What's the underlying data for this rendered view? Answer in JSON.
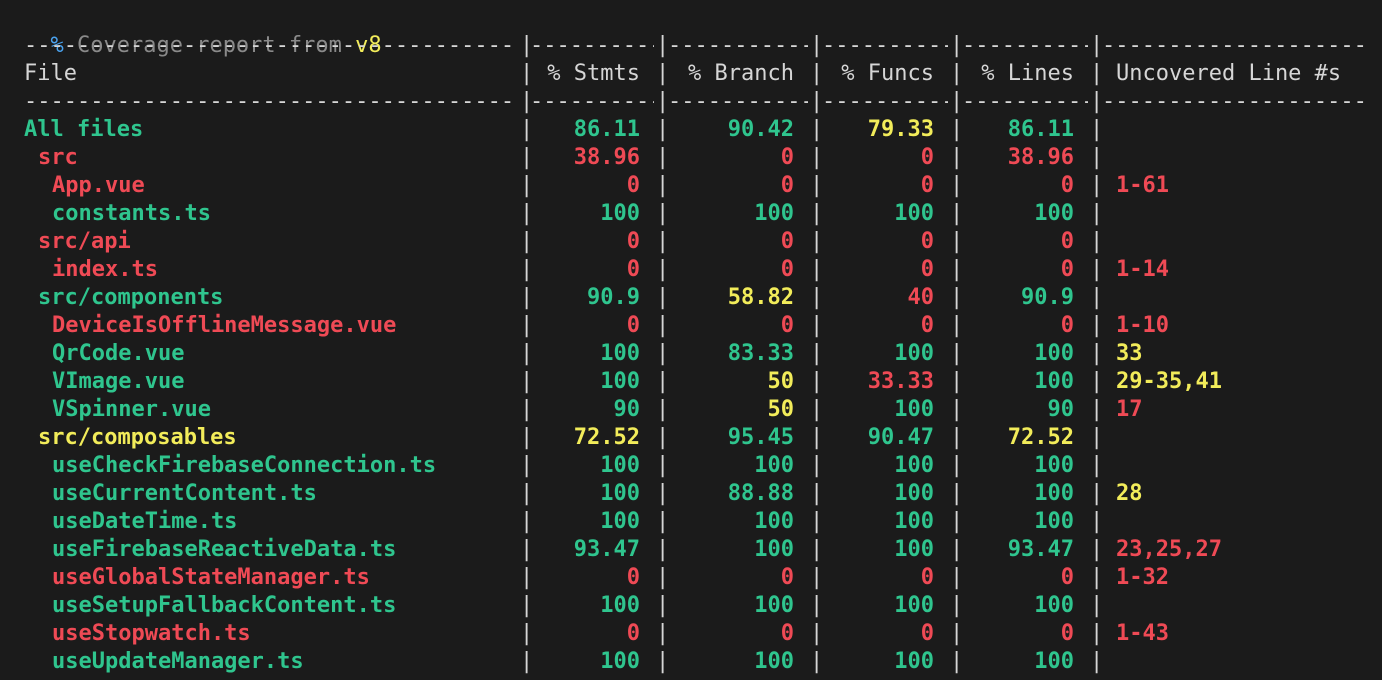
{
  "title": {
    "prefix": "%",
    "text": " Coverage report from ",
    "provider": "v8"
  },
  "columns": {
    "file": "File",
    "stmts": "% Stmts",
    "branch": "% Branch",
    "funcs": "% Funcs",
    "lines": "% Lines",
    "uncovered": "Uncovered Line #s"
  },
  "colors": {
    "green": "#2fc58e",
    "red": "#ef4a55",
    "yellow": "#f2ec5a",
    "background": "#1b1b1b"
  },
  "rows": [
    {
      "file": "All files",
      "indent": 0,
      "fileColor": "green",
      "stmts": "86.11",
      "stmtsColor": "green",
      "branch": "90.42",
      "branchColor": "green",
      "funcs": "79.33",
      "funcsColor": "yellow",
      "lines": "86.11",
      "linesColor": "green",
      "uncovered": "",
      "uncoveredColor": "red"
    },
    {
      "file": "src",
      "indent": 1,
      "fileColor": "red",
      "stmts": "38.96",
      "stmtsColor": "red",
      "branch": "0",
      "branchColor": "red",
      "funcs": "0",
      "funcsColor": "red",
      "lines": "38.96",
      "linesColor": "red",
      "uncovered": "",
      "uncoveredColor": "red"
    },
    {
      "file": "App.vue",
      "indent": 2,
      "fileColor": "red",
      "stmts": "0",
      "stmtsColor": "red",
      "branch": "0",
      "branchColor": "red",
      "funcs": "0",
      "funcsColor": "red",
      "lines": "0",
      "linesColor": "red",
      "uncovered": "1-61",
      "uncoveredColor": "red"
    },
    {
      "file": "constants.ts",
      "indent": 2,
      "fileColor": "green",
      "stmts": "100",
      "stmtsColor": "green",
      "branch": "100",
      "branchColor": "green",
      "funcs": "100",
      "funcsColor": "green",
      "lines": "100",
      "linesColor": "green",
      "uncovered": "",
      "uncoveredColor": "red"
    },
    {
      "file": "src/api",
      "indent": 1,
      "fileColor": "red",
      "stmts": "0",
      "stmtsColor": "red",
      "branch": "0",
      "branchColor": "red",
      "funcs": "0",
      "funcsColor": "red",
      "lines": "0",
      "linesColor": "red",
      "uncovered": "",
      "uncoveredColor": "red"
    },
    {
      "file": "index.ts",
      "indent": 2,
      "fileColor": "red",
      "stmts": "0",
      "stmtsColor": "red",
      "branch": "0",
      "branchColor": "red",
      "funcs": "0",
      "funcsColor": "red",
      "lines": "0",
      "linesColor": "red",
      "uncovered": "1-14",
      "uncoveredColor": "red"
    },
    {
      "file": "src/components",
      "indent": 1,
      "fileColor": "green",
      "stmts": "90.9",
      "stmtsColor": "green",
      "branch": "58.82",
      "branchColor": "yellow",
      "funcs": "40",
      "funcsColor": "red",
      "lines": "90.9",
      "linesColor": "green",
      "uncovered": "",
      "uncoveredColor": "red"
    },
    {
      "file": "DeviceIsOfflineMessage.vue",
      "indent": 2,
      "fileColor": "red",
      "stmts": "0",
      "stmtsColor": "red",
      "branch": "0",
      "branchColor": "red",
      "funcs": "0",
      "funcsColor": "red",
      "lines": "0",
      "linesColor": "red",
      "uncovered": "1-10",
      "uncoveredColor": "red"
    },
    {
      "file": "QrCode.vue",
      "indent": 2,
      "fileColor": "green",
      "stmts": "100",
      "stmtsColor": "green",
      "branch": "83.33",
      "branchColor": "green",
      "funcs": "100",
      "funcsColor": "green",
      "lines": "100",
      "linesColor": "green",
      "uncovered": "33",
      "uncoveredColor": "yellow"
    },
    {
      "file": "VImage.vue",
      "indent": 2,
      "fileColor": "green",
      "stmts": "100",
      "stmtsColor": "green",
      "branch": "50",
      "branchColor": "yellow",
      "funcs": "33.33",
      "funcsColor": "red",
      "lines": "100",
      "linesColor": "green",
      "uncovered": "29-35,41",
      "uncoveredColor": "yellow"
    },
    {
      "file": "VSpinner.vue",
      "indent": 2,
      "fileColor": "green",
      "stmts": "90",
      "stmtsColor": "green",
      "branch": "50",
      "branchColor": "yellow",
      "funcs": "100",
      "funcsColor": "green",
      "lines": "90",
      "linesColor": "green",
      "uncovered": "17",
      "uncoveredColor": "red"
    },
    {
      "file": "src/composables",
      "indent": 1,
      "fileColor": "yellow",
      "stmts": "72.52",
      "stmtsColor": "yellow",
      "branch": "95.45",
      "branchColor": "green",
      "funcs": "90.47",
      "funcsColor": "green",
      "lines": "72.52",
      "linesColor": "yellow",
      "uncovered": "",
      "uncoveredColor": "red"
    },
    {
      "file": "useCheckFirebaseConnection.ts",
      "indent": 2,
      "fileColor": "green",
      "stmts": "100",
      "stmtsColor": "green",
      "branch": "100",
      "branchColor": "green",
      "funcs": "100",
      "funcsColor": "green",
      "lines": "100",
      "linesColor": "green",
      "uncovered": "",
      "uncoveredColor": "red"
    },
    {
      "file": "useCurrentContent.ts",
      "indent": 2,
      "fileColor": "green",
      "stmts": "100",
      "stmtsColor": "green",
      "branch": "88.88",
      "branchColor": "green",
      "funcs": "100",
      "funcsColor": "green",
      "lines": "100",
      "linesColor": "green",
      "uncovered": "28",
      "uncoveredColor": "yellow"
    },
    {
      "file": "useDateTime.ts",
      "indent": 2,
      "fileColor": "green",
      "stmts": "100",
      "stmtsColor": "green",
      "branch": "100",
      "branchColor": "green",
      "funcs": "100",
      "funcsColor": "green",
      "lines": "100",
      "linesColor": "green",
      "uncovered": "",
      "uncoveredColor": "red"
    },
    {
      "file": "useFirebaseReactiveData.ts",
      "indent": 2,
      "fileColor": "green",
      "stmts": "93.47",
      "stmtsColor": "green",
      "branch": "100",
      "branchColor": "green",
      "funcs": "100",
      "funcsColor": "green",
      "lines": "93.47",
      "linesColor": "green",
      "uncovered": "23,25,27",
      "uncoveredColor": "red"
    },
    {
      "file": "useGlobalStateManager.ts",
      "indent": 2,
      "fileColor": "red",
      "stmts": "0",
      "stmtsColor": "red",
      "branch": "0",
      "branchColor": "red",
      "funcs": "0",
      "funcsColor": "red",
      "lines": "0",
      "linesColor": "red",
      "uncovered": "1-32",
      "uncoveredColor": "red"
    },
    {
      "file": "useSetupFallbackContent.ts",
      "indent": 2,
      "fileColor": "green",
      "stmts": "100",
      "stmtsColor": "green",
      "branch": "100",
      "branchColor": "green",
      "funcs": "100",
      "funcsColor": "green",
      "lines": "100",
      "linesColor": "green",
      "uncovered": "",
      "uncoveredColor": "red"
    },
    {
      "file": "useStopwatch.ts",
      "indent": 2,
      "fileColor": "red",
      "stmts": "0",
      "stmtsColor": "red",
      "branch": "0",
      "branchColor": "red",
      "funcs": "0",
      "funcsColor": "red",
      "lines": "0",
      "linesColor": "red",
      "uncovered": "1-43",
      "uncoveredColor": "red"
    },
    {
      "file": "useUpdateManager.ts",
      "indent": 2,
      "fileColor": "green",
      "stmts": "100",
      "stmtsColor": "green",
      "branch": "100",
      "branchColor": "green",
      "funcs": "100",
      "funcsColor": "green",
      "lines": "100",
      "linesColor": "green",
      "uncovered": "",
      "uncoveredColor": "red"
    }
  ]
}
